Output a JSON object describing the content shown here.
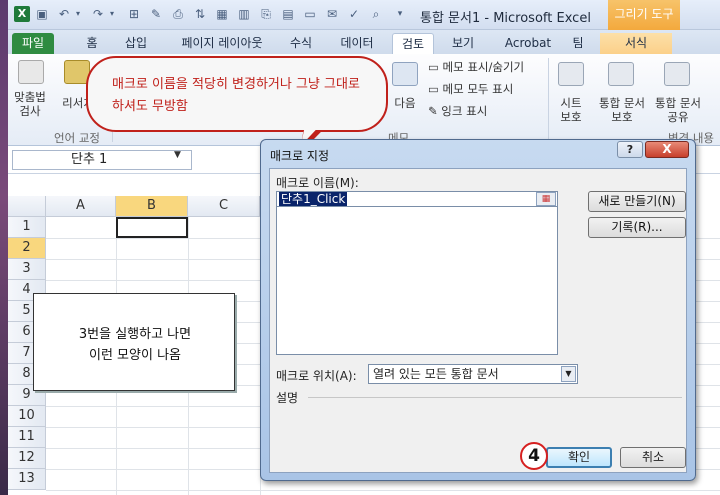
{
  "window": {
    "title": "통합 문서1 - Microsoft Excel",
    "context_tab_header": "그리기 도구"
  },
  "tabs": [
    "파일",
    "홈",
    "삽입",
    "페이지 레이아웃",
    "수식",
    "데이터",
    "검토",
    "보기",
    "Acrobat",
    "팀",
    "서식"
  ],
  "ribbon": {
    "spellcheck_line1": "맞춤법",
    "spellcheck_line2": "검사",
    "research": "리서치",
    "proofing_group": "언어 교정",
    "next_comment": "다음",
    "show_hide_comment": "메모 표시/숨기기",
    "show_all_comments": "메모 모두 표시",
    "show_ink": "잉크 표시",
    "comments_group": "메모",
    "protect_sheet_line1": "시트",
    "protect_sheet_line2": "보호",
    "protect_workbook_line1": "통합 문서",
    "protect_workbook_line2": "보호",
    "share_workbook_line1": "통합 문서",
    "share_workbook_line2": "공유",
    "changes_group": "변경 내용"
  },
  "callout": {
    "text": "매크로 이름을 적당히 변경하거나 그냥 그대로 하셔도 무방함"
  },
  "name_box": {
    "value": "단추 1"
  },
  "grid": {
    "columns": [
      "A",
      "B",
      "C"
    ],
    "rows": [
      "1",
      "2",
      "3",
      "4",
      "5",
      "6",
      "7",
      "8",
      "9",
      "10",
      "11",
      "12",
      "13"
    ]
  },
  "note": {
    "line1": "3번을 실행하고 나면",
    "line2": "이런 모양이 나옴"
  },
  "dialog": {
    "title": "매크로 지정",
    "help": "?",
    "close": "X",
    "macro_name_label": "매크로 이름(M):",
    "macro_name_value": "단추1_Click",
    "new_button": "새로 만들기(N)",
    "record_button": "기록(R)...",
    "location_label": "매크로 위치(A):",
    "location_value": "열려 있는 모든 통합 문서",
    "description_label": "설명",
    "ok_button": "확인",
    "cancel_button": "취소",
    "step_badge": "4"
  }
}
